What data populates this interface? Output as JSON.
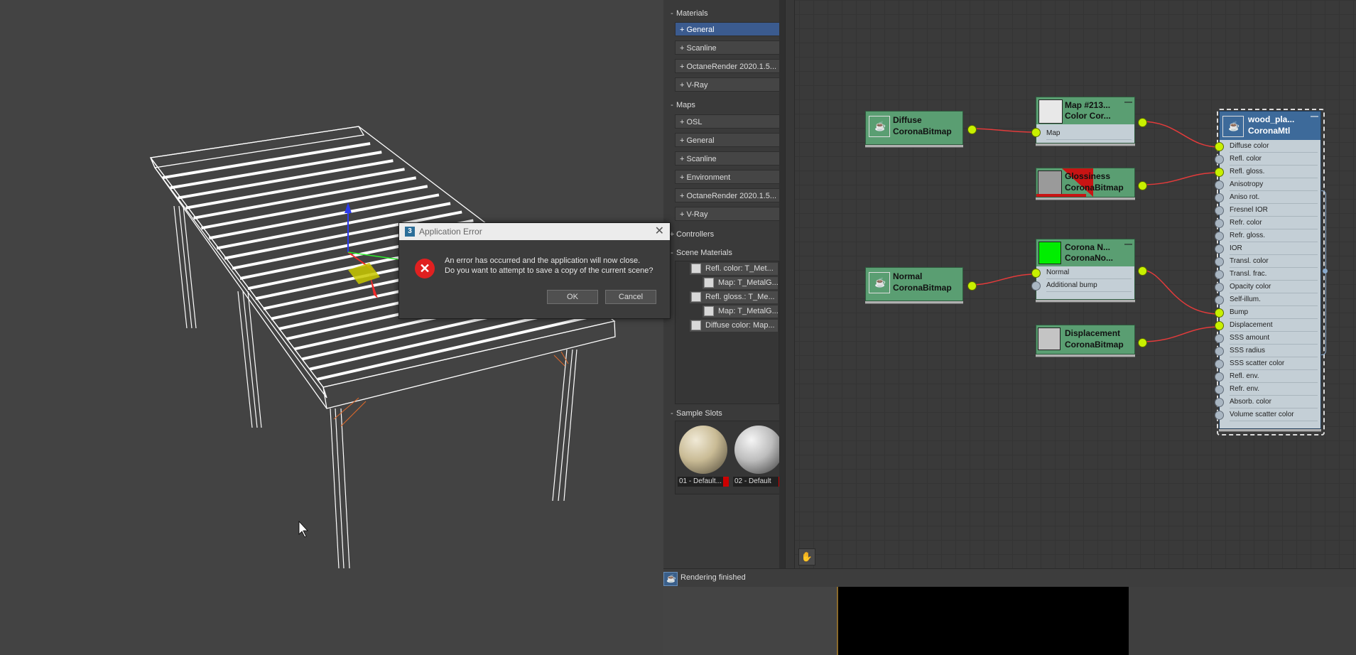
{
  "browser": {
    "materials": {
      "header": "Materials",
      "items": [
        "General",
        "Scanline",
        "OctaneRender 2020.1.5...",
        "V-Ray"
      ]
    },
    "maps": {
      "header": "Maps",
      "items": [
        "OSL",
        "General",
        "Scanline",
        "Environment",
        "OctaneRender 2020.1.5...",
        "V-Ray"
      ]
    },
    "controllers": {
      "header": "Controllers"
    },
    "scene_materials": {
      "header": "Scene Materials",
      "rows": [
        "Refl. color: T_Met...",
        "Map: T_MetalG...",
        "Refl. gloss.: T_Me...",
        "Map: T_MetalG...",
        "Diffuse color: Map..."
      ]
    },
    "sample_slots": {
      "header": "Sample Slots",
      "slots": [
        "01 - Default...",
        "02 - Default"
      ]
    }
  },
  "nodes": {
    "diffuse": {
      "line1": "Diffuse",
      "line2": "CoronaBitmap"
    },
    "map213": {
      "line1": "Map #213...",
      "line2": "Color Cor...",
      "slot": "Map"
    },
    "glossiness": {
      "line1": "Glossiness",
      "line2": "CoronaBitmap"
    },
    "normal": {
      "line1": "Normal",
      "line2": "CoronaBitmap"
    },
    "corona_normal": {
      "line1": "Corona N...",
      "line2": "CoronaNo...",
      "slots": [
        "Normal",
        "Additional bump"
      ]
    },
    "displacement": {
      "line1": "Displacement",
      "line2": "CoronaBitmap"
    },
    "material": {
      "line1": "wood_pla...",
      "line2": "CoronaMtl",
      "slots": [
        "Diffuse color",
        "Refl. color",
        "Refl. gloss.",
        "Anisotropy",
        "Aniso rot.",
        "Fresnel IOR",
        "Refr. color",
        "Refr. gloss.",
        "IOR",
        "Transl. color",
        "Transl. frac.",
        "Opacity color",
        "Self-illum.",
        "Bump",
        "Displacement",
        "SSS amount",
        "SSS radius",
        "SSS scatter color",
        "Refl. env.",
        "Refr. env.",
        "Absorb. color",
        "Volume scatter color"
      ],
      "connected": [
        0,
        2,
        13,
        14
      ]
    }
  },
  "dialog": {
    "title": "Application Error",
    "message_line1": "An error has occurred and the application will now close.",
    "message_line2": "Do you want to attempt to save a copy of the current scene?",
    "ok": "OK",
    "cancel": "Cancel"
  },
  "status": {
    "text": "Rendering finished"
  },
  "colors": {
    "node": "#5a9e72",
    "selected": "#3b5b8f",
    "port_connected": "#c8f000",
    "wire": "#e23b3b"
  }
}
